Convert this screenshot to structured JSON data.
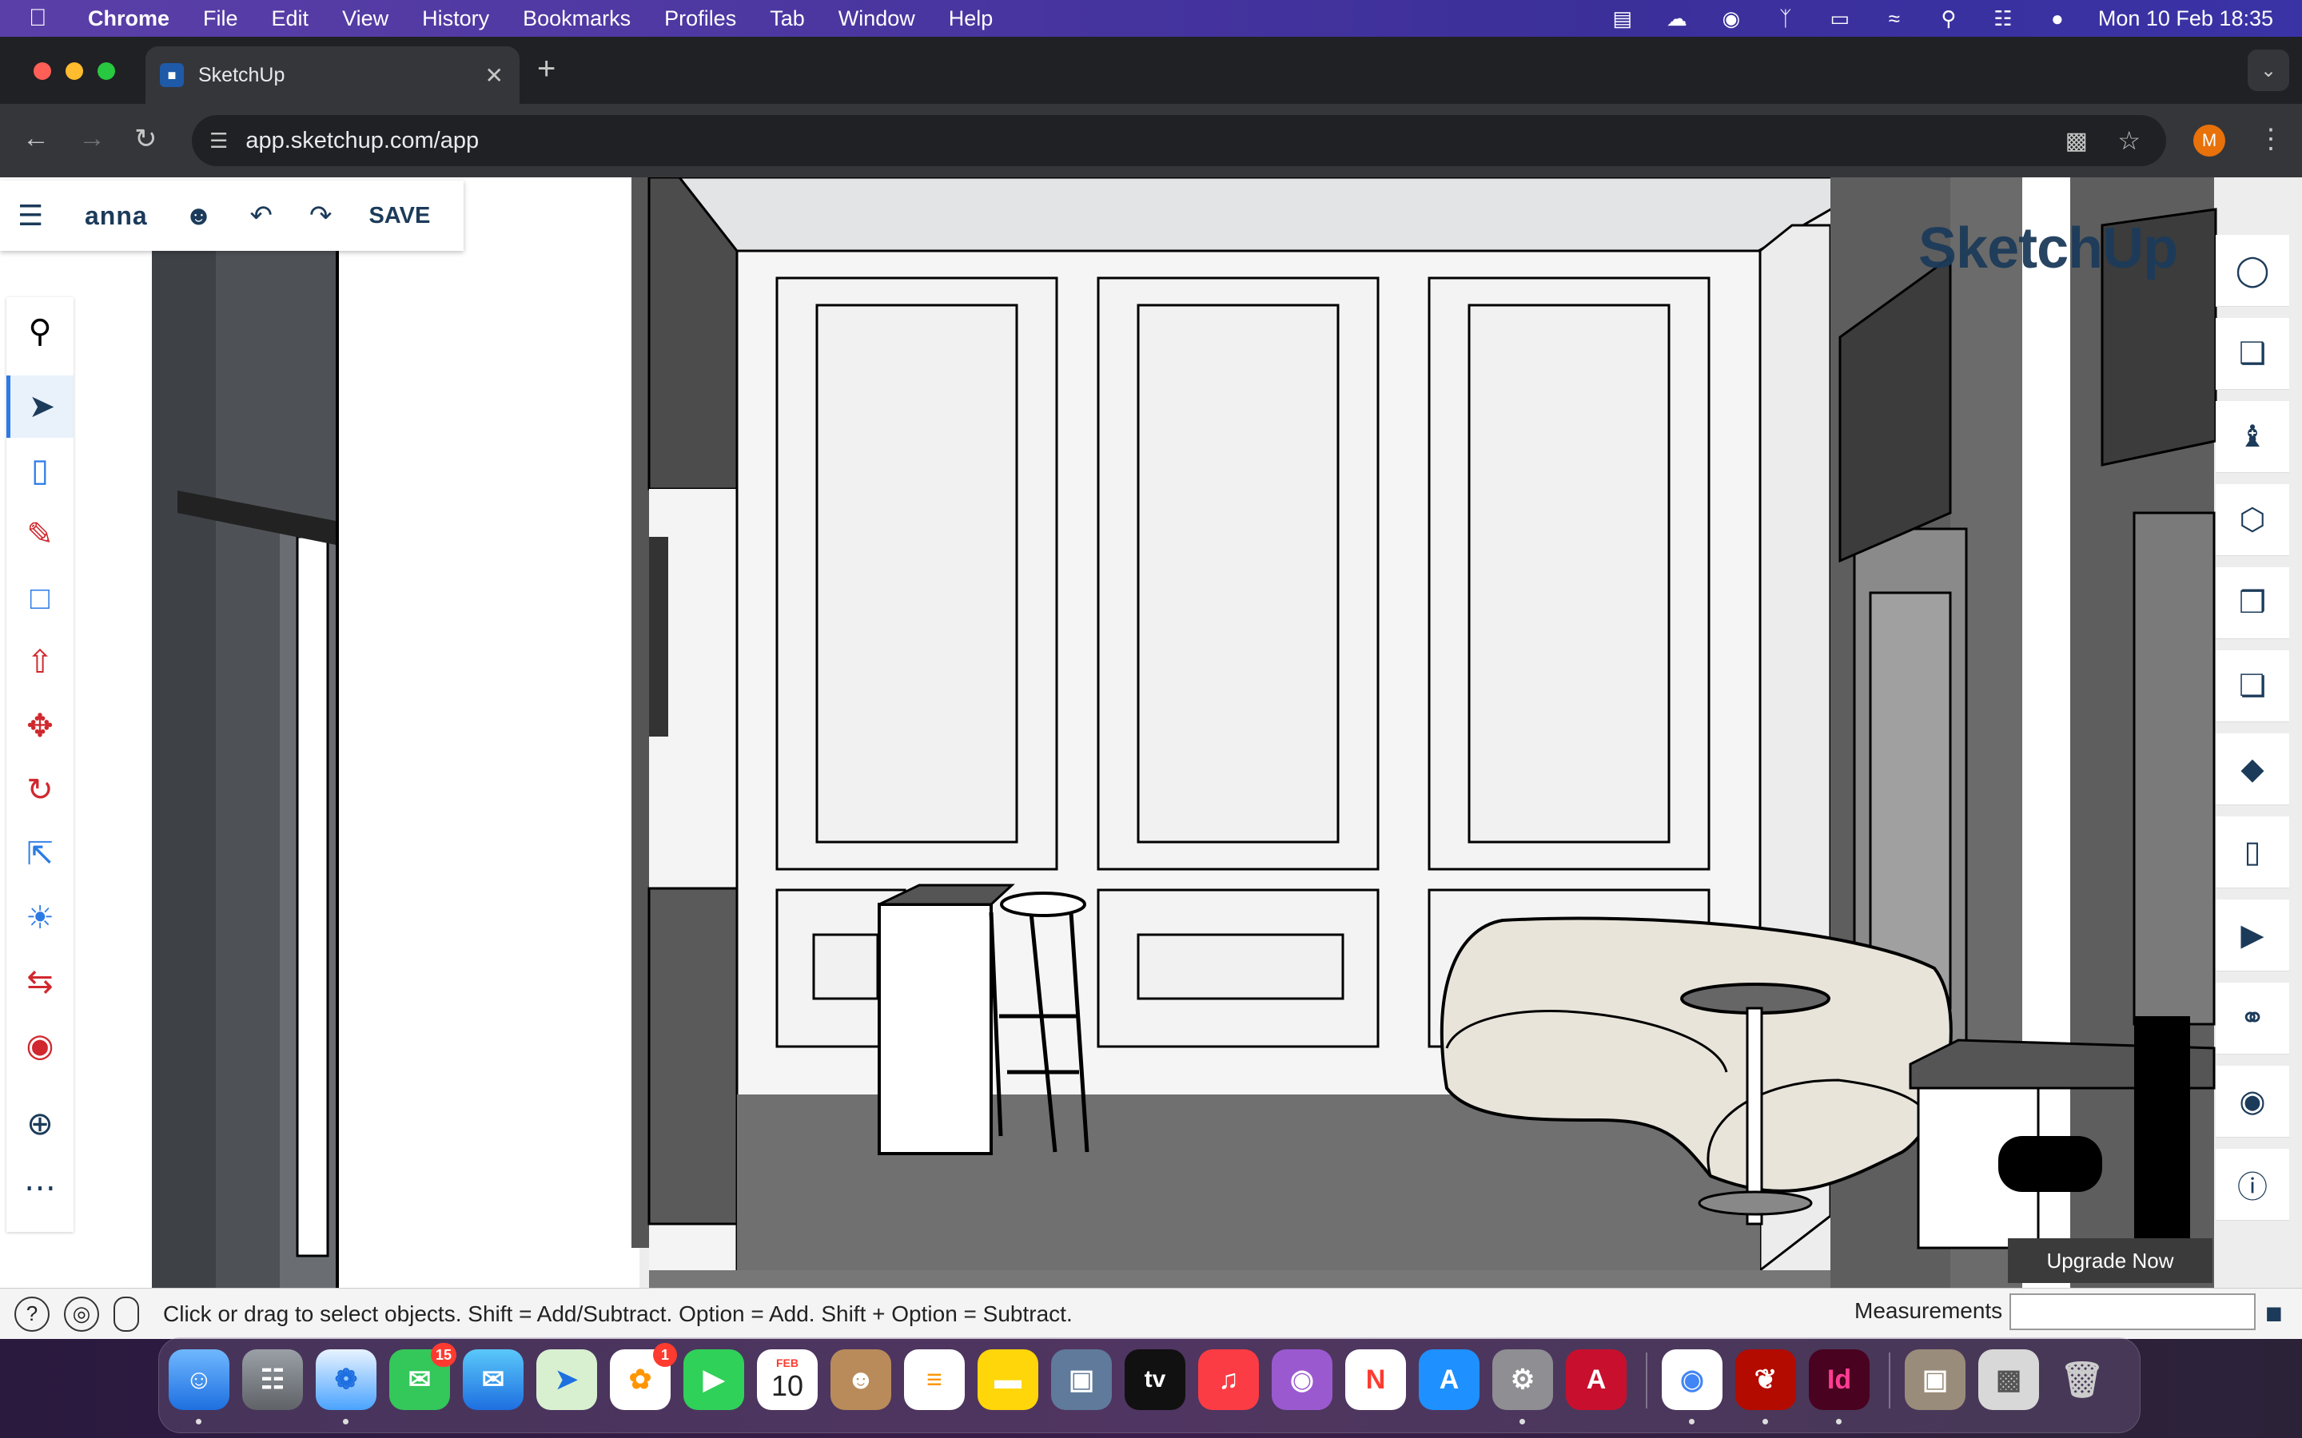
{
  "menubar": {
    "app_name": "Chrome",
    "items": [
      "File",
      "Edit",
      "View",
      "History",
      "Bookmarks",
      "Profiles",
      "Tab",
      "Window",
      "Help"
    ],
    "datetime": "Mon 10 Feb  18:35"
  },
  "browser": {
    "tab_title": "SketchUp",
    "url": "app.sketchup.com/app",
    "profile_initial": "M"
  },
  "app": {
    "user_name": "anna",
    "save_label": "SAVE",
    "brand": "SketchUp",
    "upgrade_label": "Upgrade Now",
    "status_hint": "Click or drag to select objects. Shift = Add/Subtract. Option = Add. Shift + Option = Subtract.",
    "measurements_label": "Measurements",
    "more_tools": "⋯"
  },
  "dock": {
    "messages_badge": "15",
    "photos_badge": "1",
    "calendar_month": "FEB",
    "calendar_day": "10",
    "appletv_label": "tv",
    "autocad_label": "A",
    "indesign_label": "Id"
  },
  "colors": {
    "sketchup_blue": "#1c3b5a",
    "menubar_purple": "#4a36a0",
    "chrome_dark": "#202124"
  }
}
